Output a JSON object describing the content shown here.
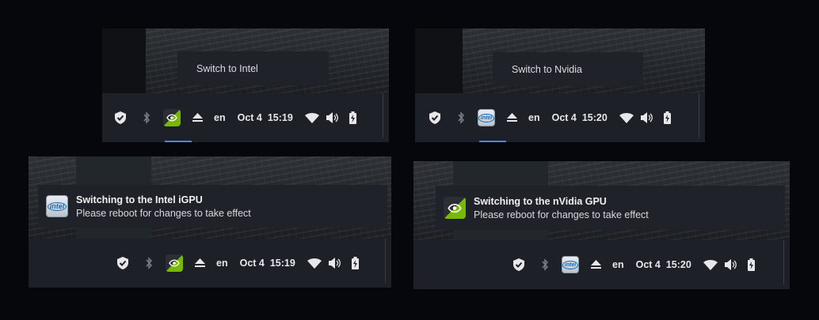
{
  "colors": {
    "accent": "#3d8ee8",
    "nvidia_green": "#76b900",
    "intel_blue": "#1669b7",
    "bar_bg": "#1d2027"
  },
  "panel_tl": {
    "popup_item": "Switch to Intel",
    "tray": {
      "gpu_icon": "nvidia-icon",
      "lang": "en",
      "date": "Oct 4",
      "time": "15:19"
    }
  },
  "panel_tr": {
    "popup_item": "Switch to Nvidia",
    "tray": {
      "gpu_icon": "intel-icon",
      "lang": "en",
      "date": "Oct 4",
      "time": "15:20"
    }
  },
  "panel_bl": {
    "notification": {
      "icon": "intel-icon",
      "title": "Switching to the Intel iGPU",
      "body": "Please reboot for changes to take effect"
    },
    "tray": {
      "gpu_icon": "nvidia-icon",
      "lang": "en",
      "date": "Oct 4",
      "time": "15:19"
    }
  },
  "panel_br": {
    "notification": {
      "icon": "nvidia-icon",
      "title": "Switching to the nVidia GPU",
      "body": "Please reboot for changes to take effect"
    },
    "tray": {
      "gpu_icon": "intel-icon",
      "lang": "en",
      "date": "Oct 4",
      "time": "15:20"
    }
  },
  "intel_logo_text": "intel"
}
